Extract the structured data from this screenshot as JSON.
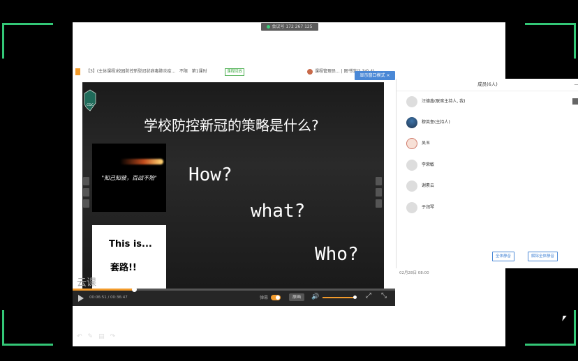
{
  "meeting": {
    "id_label": "会议号 172 267 125"
  },
  "topbar": {
    "course_title": "【3】(主体课程)校园防控新型冠状病毒肺炎疫...",
    "level": "不限",
    "lesson": "第1课时",
    "tag": "课程回放",
    "teacher": "课程管理员...",
    "extra": "| 图书馆(2.3/0.4)..."
  },
  "mini_window": {
    "label": "显示窗口模式",
    "close": "×"
  },
  "slide": {
    "title": "学校防控新冠的策略是什么?",
    "motto": "\"知己知彼，百战不殆\"",
    "how": "How?",
    "what": "what?",
    "who": "Who?",
    "joke_line1": "This is...",
    "joke_line2": "套路!!",
    "logo_text": "CDC"
  },
  "player": {
    "progress": 0.19,
    "time": "00:06:51 / 00:36:47",
    "danmu_label": "弹幕",
    "quality": "原画",
    "volume": 0.9,
    "watermark": "云课"
  },
  "panel": {
    "title": "成员(6人)",
    "minimize": "—",
    "members": [
      {
        "name": "汪德鑫(联席主持人, 我)",
        "avatar": "default"
      },
      {
        "name": "穆英奎(主持人)",
        "avatar": "photo"
      },
      {
        "name": "吴玉",
        "avatar": "cartoon"
      },
      {
        "name": "李荣敏",
        "avatar": "default"
      },
      {
        "name": "谢素云",
        "avatar": "default"
      },
      {
        "name": "于润琴",
        "avatar": "default"
      }
    ],
    "mute_all": "全体静音",
    "unmute_all": "解除全体静音"
  },
  "chat": {
    "date": "02月28日 08:00"
  },
  "colors": {
    "accent": "#f39b2b",
    "frame": "#33c777",
    "primary": "#4a88d6"
  }
}
